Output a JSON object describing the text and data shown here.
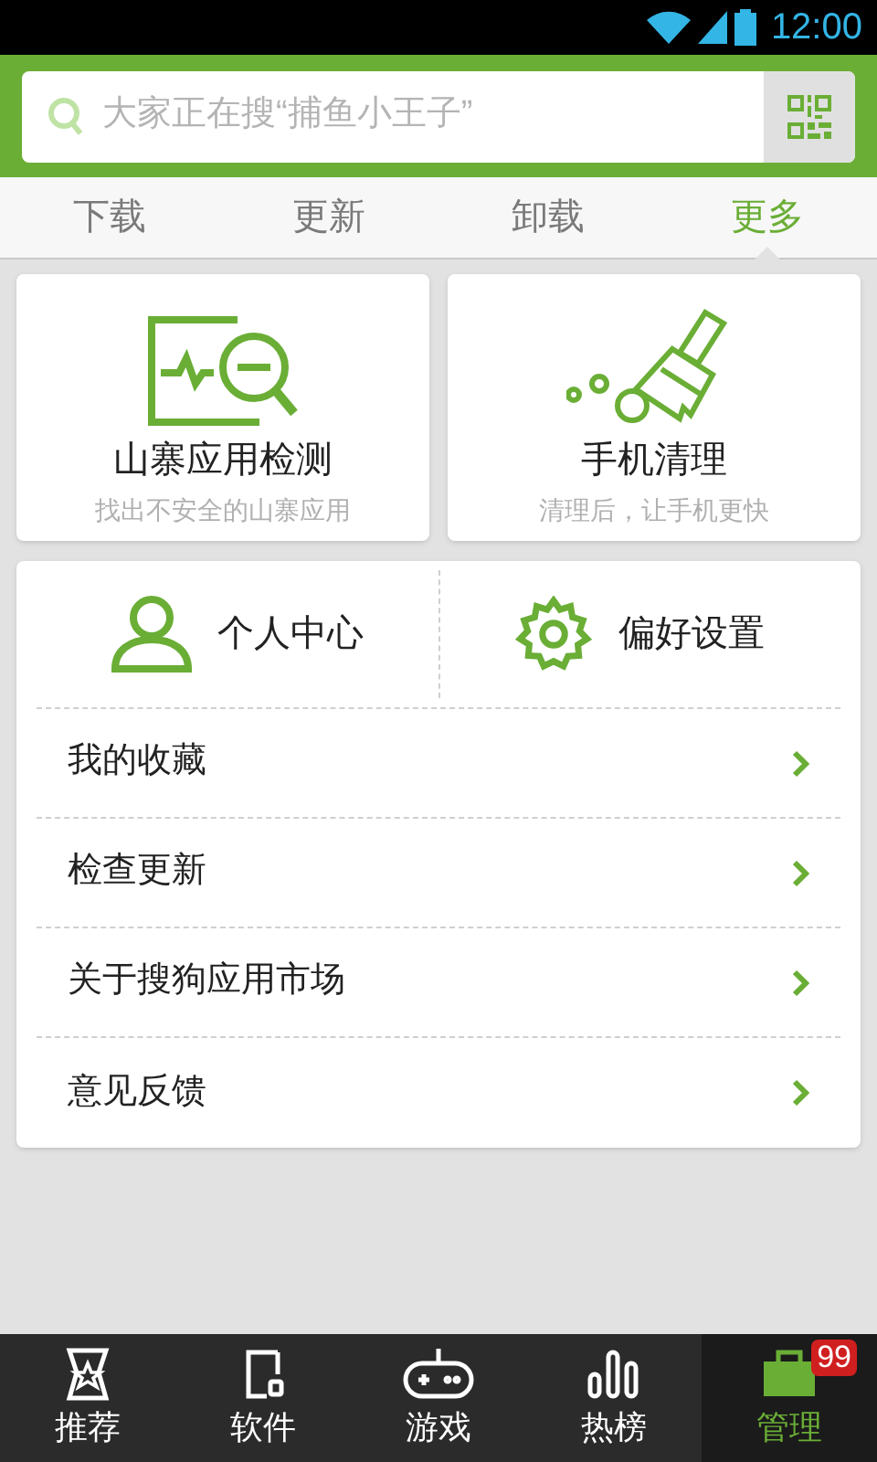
{
  "status_bar": {
    "time": "12:00"
  },
  "search": {
    "placeholder": "大家正在搜“捕鱼小王子”"
  },
  "tabs": [
    {
      "label": "下载",
      "selected": false
    },
    {
      "label": "更新",
      "selected": false
    },
    {
      "label": "卸载",
      "selected": false
    },
    {
      "label": "更多",
      "selected": true
    }
  ],
  "feature_cards": [
    {
      "kind": "scan",
      "title": "山寨应用检测",
      "subtitle": "找出不安全的山寨应用"
    },
    {
      "kind": "clean",
      "title": "手机清理",
      "subtitle": "清理后，让手机更快"
    }
  ],
  "shortcuts": [
    {
      "kind": "user",
      "label": "个人中心"
    },
    {
      "kind": "settings",
      "label": "偏好设置"
    }
  ],
  "menu_items": [
    {
      "label": "我的收藏"
    },
    {
      "label": "检查更新"
    },
    {
      "label": "关于搜狗应用市场"
    },
    {
      "label": "意见反馈"
    }
  ],
  "bottom_nav": [
    {
      "kind": "star",
      "label": "推荐",
      "selected": false
    },
    {
      "kind": "apps",
      "label": "软件",
      "selected": false
    },
    {
      "kind": "gamepad",
      "label": "游戏",
      "selected": false
    },
    {
      "kind": "chart",
      "label": "热榜",
      "selected": false
    },
    {
      "kind": "briefcase",
      "label": "管理",
      "selected": true,
      "badge": "99"
    }
  ]
}
